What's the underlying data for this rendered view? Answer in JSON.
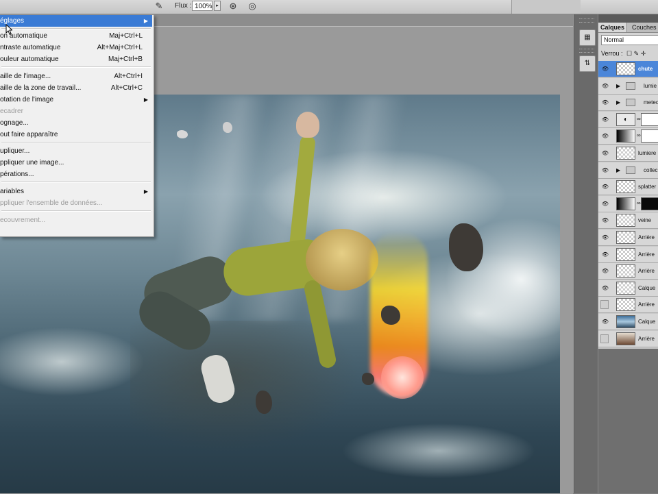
{
  "options_bar": {
    "flux_label": "Flux :",
    "flux_value": "100%"
  },
  "image_menu": {
    "items": [
      {
        "label": "églages",
        "shortcut": "",
        "submenu": true,
        "highlighted": true,
        "disabled": false
      },
      {
        "label": "on automatique",
        "shortcut": "Maj+Ctrl+L",
        "submenu": false,
        "highlighted": false,
        "disabled": false
      },
      {
        "label": "ntraste automatique",
        "shortcut": "Alt+Maj+Ctrl+L",
        "submenu": false,
        "highlighted": false,
        "disabled": false
      },
      {
        "label": "ouleur automatique",
        "shortcut": "Maj+Ctrl+B",
        "submenu": false,
        "highlighted": false,
        "disabled": false
      },
      {
        "label": "aille de l'image...",
        "shortcut": "Alt+Ctrl+I",
        "submenu": false,
        "highlighted": false,
        "disabled": false
      },
      {
        "label": "aille de la zone de travail...",
        "shortcut": "Alt+Ctrl+C",
        "submenu": false,
        "highlighted": false,
        "disabled": false
      },
      {
        "label": "otation de l'image",
        "shortcut": "",
        "submenu": true,
        "highlighted": false,
        "disabled": false
      },
      {
        "label": "ecadrer",
        "shortcut": "",
        "submenu": false,
        "highlighted": false,
        "disabled": true
      },
      {
        "label": "ognage...",
        "shortcut": "",
        "submenu": false,
        "highlighted": false,
        "disabled": false
      },
      {
        "label": "out faire apparaître",
        "shortcut": "",
        "submenu": false,
        "highlighted": false,
        "disabled": false
      },
      {
        "label": "upliquer...",
        "shortcut": "",
        "submenu": false,
        "highlighted": false,
        "disabled": false
      },
      {
        "label": "ppliquer une image...",
        "shortcut": "",
        "submenu": false,
        "highlighted": false,
        "disabled": false
      },
      {
        "label": "pérations...",
        "shortcut": "",
        "submenu": false,
        "highlighted": false,
        "disabled": false
      },
      {
        "label": "ariables",
        "shortcut": "",
        "submenu": true,
        "highlighted": false,
        "disabled": false
      },
      {
        "label": "ppliquer l'ensemble de données...",
        "shortcut": "",
        "submenu": false,
        "highlighted": false,
        "disabled": true
      },
      {
        "label": "ecouvrement...",
        "shortcut": "",
        "submenu": false,
        "highlighted": false,
        "disabled": true
      }
    ]
  },
  "layers_panel": {
    "tabs": [
      "Calques",
      "Couches"
    ],
    "blend_mode": "Normal",
    "lock_label": "Verrou :",
    "layers": [
      {
        "name": "chute",
        "kind": "layer",
        "visible": true,
        "selected": true,
        "thumb": "transparent"
      },
      {
        "name": "lumie",
        "kind": "group",
        "visible": true,
        "selected": false
      },
      {
        "name": "meteo",
        "kind": "group",
        "visible": true,
        "selected": false
      },
      {
        "name": "",
        "kind": "adjustment",
        "visible": true,
        "selected": false,
        "mask": "white"
      },
      {
        "name": "",
        "kind": "gradient",
        "visible": true,
        "selected": false,
        "mask": "white"
      },
      {
        "name": "lumiere",
        "kind": "layer",
        "visible": true,
        "selected": false,
        "thumb": "transparent"
      },
      {
        "name": "collec",
        "kind": "group",
        "visible": true,
        "selected": false
      },
      {
        "name": "splatter",
        "kind": "layer",
        "visible": true,
        "selected": false,
        "thumb": "transparent"
      },
      {
        "name": "",
        "kind": "gradient",
        "visible": true,
        "selected": false,
        "mask": "dark"
      },
      {
        "name": "veine",
        "kind": "layer",
        "visible": true,
        "selected": false,
        "thumb": "transparent"
      },
      {
        "name": "Arrière",
        "kind": "layer",
        "visible": true,
        "selected": false,
        "thumb": "transparent"
      },
      {
        "name": "Arrière",
        "kind": "layer",
        "visible": true,
        "selected": false,
        "thumb": "transparent"
      },
      {
        "name": "Arrière",
        "kind": "layer",
        "visible": true,
        "selected": false,
        "thumb": "transparent"
      },
      {
        "name": "Calque",
        "kind": "layer",
        "visible": true,
        "selected": false,
        "thumb": "transparent"
      },
      {
        "name": "Arrière",
        "kind": "layer",
        "visible": false,
        "selected": false,
        "thumb": "transparent"
      },
      {
        "name": "Calque",
        "kind": "layer",
        "visible": true,
        "selected": false,
        "thumb": "sky"
      },
      {
        "name": "Arrière",
        "kind": "layer",
        "visible": false,
        "selected": false,
        "thumb": "photo"
      }
    ]
  },
  "colors": {
    "menu_highlight": "#3a7bd5",
    "selected_layer": "#4b86d9",
    "meteor": "#f7b021"
  }
}
